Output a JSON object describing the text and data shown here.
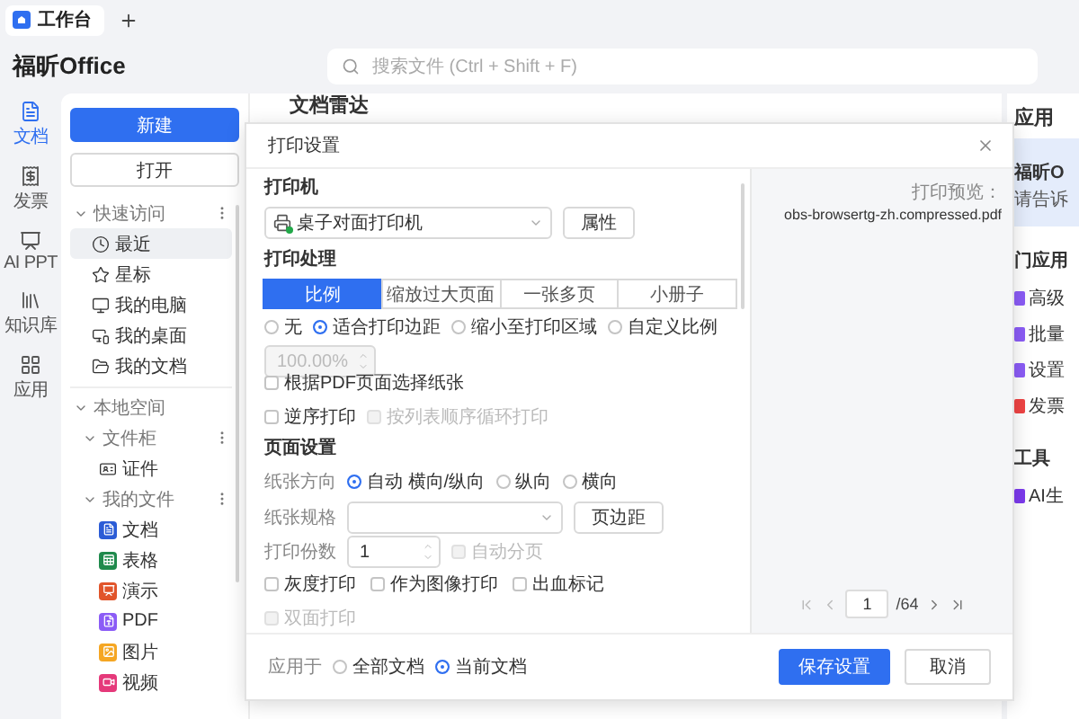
{
  "tabs": [
    {
      "label": "工作台",
      "selected": true
    }
  ],
  "app_title": "福昕Office",
  "search": {
    "placeholder": "搜索文件 (Ctrl + Shift + F)"
  },
  "rail": [
    {
      "kind": "document",
      "label": "文档",
      "selected": true
    },
    {
      "kind": "invoice",
      "label": "发票",
      "selected": false
    },
    {
      "kind": "ppt",
      "label": "AI PPT",
      "selected": false
    },
    {
      "kind": "library",
      "label": "知识库",
      "selected": false
    },
    {
      "kind": "apps",
      "label": "应用",
      "selected": false
    }
  ],
  "sidebar": {
    "buttons": [
      {
        "kind": "primary",
        "label": "新建"
      },
      {
        "kind": "secondary",
        "label": "打开"
      }
    ],
    "tree": [
      {
        "label": "快速访问",
        "expanded": true,
        "more": true,
        "children": [
          {
            "kind": "clock",
            "label": "最近",
            "selected": true
          },
          {
            "kind": "star",
            "label": "星标",
            "selected": false
          },
          {
            "kind": "computer",
            "label": "我的电脑",
            "selected": false
          },
          {
            "kind": "desktop",
            "label": "我的桌面",
            "selected": false
          },
          {
            "kind": "folder",
            "label": "我的文档",
            "selected": false
          }
        ]
      },
      {
        "label": "本地空间",
        "expanded": true,
        "more": false,
        "children": [
          {
            "label": "文件柜",
            "expanded": true,
            "more": true,
            "children": [
              {
                "kind": "id",
                "label": "证件",
                "selected": false
              }
            ]
          },
          {
            "label": "我的文件",
            "expanded": true,
            "more": true,
            "children": [
              {
                "kind": "word",
                "label": "文档",
                "selected": false
              },
              {
                "kind": "sheet",
                "label": "表格",
                "selected": false
              },
              {
                "kind": "slides",
                "label": "演示",
                "selected": false
              },
              {
                "kind": "pdf",
                "label": "PDF",
                "selected": false
              },
              {
                "kind": "image",
                "label": "图片",
                "selected": false
              },
              {
                "kind": "video",
                "label": "视频",
                "selected": false
              }
            ]
          }
        ]
      }
    ]
  },
  "main": {
    "heading": "文档雷达"
  },
  "apps_panel": {
    "title": "应用",
    "banner": {
      "title": "福昕O",
      "text": "请告诉"
    },
    "section": "门应用",
    "apps": [
      {
        "label": "高级",
        "color": "#8b5cf6"
      },
      {
        "label": "批量",
        "color": "#8b5cf6"
      },
      {
        "label": "设置",
        "color": "#8b5cf6"
      },
      {
        "label": "发票",
        "color": "#ef4444"
      }
    ],
    "tools_title": "工具",
    "tools": [
      {
        "label": "AI生",
        "color": "#7c3aed"
      }
    ]
  },
  "dialog": {
    "title": "打印设置",
    "printer": {
      "label": "打印机",
      "value": "桌子对面打印机",
      "online": true,
      "button": "属性"
    },
    "processing": {
      "label": "打印处理",
      "modes": [
        {
          "label": "比例",
          "selected": true
        },
        {
          "label": "缩放过大页面",
          "selected": false
        },
        {
          "label": "一张多页",
          "selected": false
        },
        {
          "label": "小册子",
          "selected": false
        }
      ],
      "scales": [
        {
          "label": "无",
          "selected": false
        },
        {
          "label": "适合打印边距",
          "selected": true
        },
        {
          "label": "缩小至打印区域",
          "selected": false
        },
        {
          "label": "自定义比例",
          "selected": false
        }
      ],
      "custom_scale": {
        "value": "100.00%",
        "disabled": true
      },
      "options": [
        {
          "label": "根据PDF页面选择纸张",
          "checked": false,
          "disabled": false
        }
      ],
      "order": [
        {
          "label": "逆序打印",
          "checked": false,
          "disabled": false
        },
        {
          "label": "按列表顺序循环打印",
          "checked": false,
          "disabled": true
        }
      ]
    },
    "page_setup": {
      "label": "页面设置",
      "orientation": {
        "label": "纸张方向",
        "options": [
          {
            "label": "自动 横向/纵向",
            "selected": true
          },
          {
            "label": "纵向",
            "selected": false
          },
          {
            "label": "横向",
            "selected": false
          }
        ]
      },
      "paper": {
        "label": "纸张规格",
        "button": "页边距"
      },
      "copies": {
        "label": "打印份数",
        "value": "1",
        "collate": {
          "label": "自动分页",
          "checked": false,
          "disabled": true
        }
      },
      "marks": [
        {
          "label": "灰度打印",
          "checked": false,
          "disabled": false
        },
        {
          "label": "作为图像打印",
          "checked": false,
          "disabled": false
        },
        {
          "label": "出血标记",
          "checked": false,
          "disabled": false
        }
      ],
      "duplex": {
        "label": "双面打印",
        "checked": false,
        "disabled": true
      }
    },
    "preview": {
      "label": "打印预览：",
      "file": "obs-browsertg-zh.compressed.pdf",
      "page": "1",
      "total": "/64"
    },
    "apply": {
      "label": "应用于",
      "options": [
        {
          "label": "全部文档",
          "selected": false
        },
        {
          "label": "当前文档",
          "selected": true
        }
      ]
    },
    "buttons": [
      {
        "kind": "primary",
        "label": "保存设置"
      },
      {
        "kind": "secondary",
        "label": "取消"
      }
    ]
  }
}
